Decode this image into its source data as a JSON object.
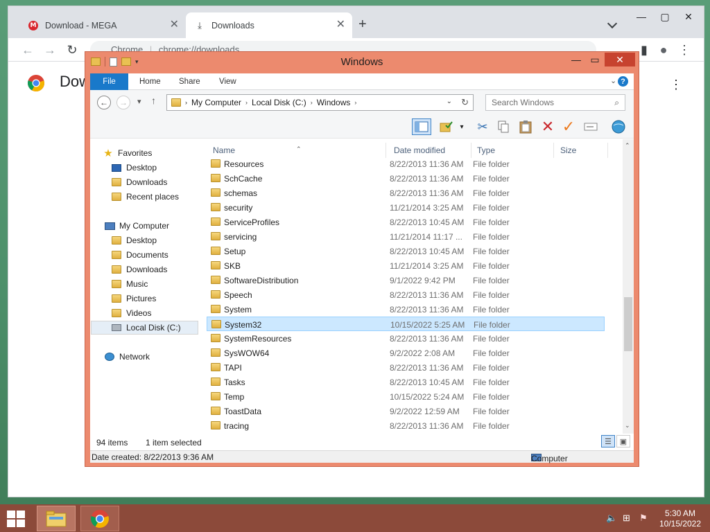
{
  "browser": {
    "tabs": [
      {
        "label": "Download - MEGA",
        "active": false
      },
      {
        "label": "Downloads",
        "active": true
      }
    ],
    "omnibox_brand": "Chrome",
    "omnibox_url": "chrome://downloads",
    "page_title": "Dow"
  },
  "explorer": {
    "title": "Windows",
    "ribbon_tabs": [
      "File",
      "Home",
      "Share",
      "View"
    ],
    "breadcrumb": [
      "My Computer",
      "Local Disk (C:)",
      "Windows"
    ],
    "search_placeholder": "Search Windows",
    "columns": {
      "name": "Name",
      "date": "Date modified",
      "type": "Type",
      "size": "Size"
    },
    "nav": {
      "favorites": {
        "label": "Favorites",
        "items": [
          "Desktop",
          "Downloads",
          "Recent places"
        ]
      },
      "computer": {
        "label": "My Computer",
        "items": [
          "Desktop",
          "Documents",
          "Downloads",
          "Music",
          "Pictures",
          "Videos",
          "Local Disk (C:)"
        ]
      },
      "network": {
        "label": "Network"
      }
    },
    "files": [
      {
        "name": "Resources",
        "date": "8/22/2013 11:36 AM",
        "type": "File folder"
      },
      {
        "name": "SchCache",
        "date": "8/22/2013 11:36 AM",
        "type": "File folder"
      },
      {
        "name": "schemas",
        "date": "8/22/2013 11:36 AM",
        "type": "File folder"
      },
      {
        "name": "security",
        "date": "11/21/2014 3:25 AM",
        "type": "File folder"
      },
      {
        "name": "ServiceProfiles",
        "date": "8/22/2013 10:45 AM",
        "type": "File folder"
      },
      {
        "name": "servicing",
        "date": "11/21/2014 11:17 ...",
        "type": "File folder"
      },
      {
        "name": "Setup",
        "date": "8/22/2013 10:45 AM",
        "type": "File folder"
      },
      {
        "name": "SKB",
        "date": "11/21/2014 3:25 AM",
        "type": "File folder"
      },
      {
        "name": "SoftwareDistribution",
        "date": "9/1/2022 9:42 PM",
        "type": "File folder"
      },
      {
        "name": "Speech",
        "date": "8/22/2013 11:36 AM",
        "type": "File folder"
      },
      {
        "name": "System",
        "date": "8/22/2013 11:36 AM",
        "type": "File folder"
      },
      {
        "name": "System32",
        "date": "10/15/2022 5:25 AM",
        "type": "File folder",
        "selected": true
      },
      {
        "name": "SystemResources",
        "date": "8/22/2013 11:36 AM",
        "type": "File folder"
      },
      {
        "name": "SysWOW64",
        "date": "9/2/2022 2:08 AM",
        "type": "File folder"
      },
      {
        "name": "TAPI",
        "date": "8/22/2013 11:36 AM",
        "type": "File folder"
      },
      {
        "name": "Tasks",
        "date": "8/22/2013 10:45 AM",
        "type": "File folder"
      },
      {
        "name": "Temp",
        "date": "10/15/2022 5:24 AM",
        "type": "File folder"
      },
      {
        "name": "ToastData",
        "date": "9/2/2022 12:59 AM",
        "type": "File folder"
      },
      {
        "name": "tracing",
        "date": "8/22/2013 11:36 AM",
        "type": "File folder"
      }
    ],
    "status": {
      "item_count": "94 items",
      "selected": "1 item selected",
      "date_created": "Date created: 8/22/2013 9:36 AM",
      "location": "Computer"
    }
  },
  "taskbar": {
    "time": "5:30 AM",
    "date": "10/15/2022"
  },
  "colors": {
    "explorer_frame": "#ec8a6e",
    "taskbar": "#8c4a3a",
    "selection": "#cce8ff",
    "file_tab": "#1979ca"
  }
}
